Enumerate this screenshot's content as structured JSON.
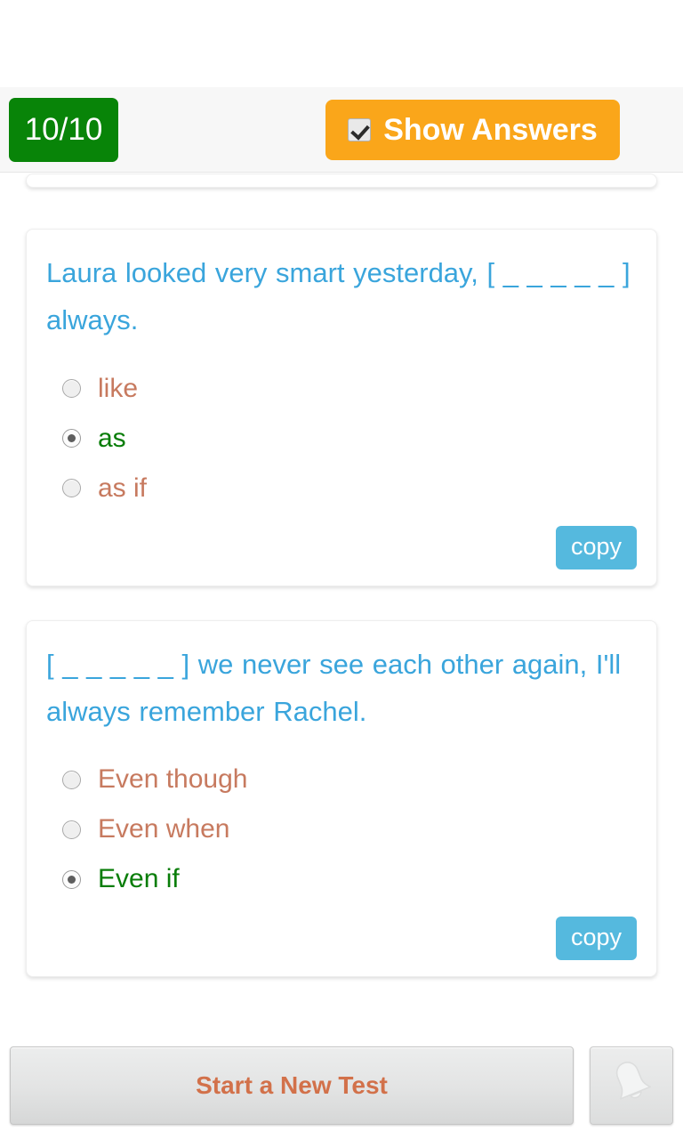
{
  "header": {
    "score_badge": "10/10",
    "score_color": "#088408",
    "show_answers_label": "Show Answers",
    "show_answers_color": "#faa61a",
    "checkbox_icon": "checkbox-checked-icon",
    "checkbox_checked": true
  },
  "theme": {
    "question_text_color": "#3aa5dc",
    "option_color": "#c77a5f",
    "correct_option_color": "#087d08",
    "copy_button_color": "#55b9de",
    "new_test_text_color": "#d2714a"
  },
  "questions": [
    {
      "text": "Laura looked very smart yesterday, [ _ _ _ _ _ ] always.",
      "copy_label": "copy",
      "options": [
        {
          "label": "like",
          "selected": false,
          "correct": false
        },
        {
          "label": "as",
          "selected": true,
          "correct": true
        },
        {
          "label": "as if",
          "selected": false,
          "correct": false
        }
      ]
    },
    {
      "text": "[ _ _ _ _ _ ] we never see each other again, I'll always remember Rachel.",
      "copy_label": "copy",
      "options": [
        {
          "label": "Even though",
          "selected": false,
          "correct": false
        },
        {
          "label": "Even when",
          "selected": false,
          "correct": false
        },
        {
          "label": "Even if",
          "selected": true,
          "correct": true
        }
      ]
    }
  ],
  "footer": {
    "new_test_label": "Start a New Test",
    "bell_icon": "bell-icon"
  }
}
